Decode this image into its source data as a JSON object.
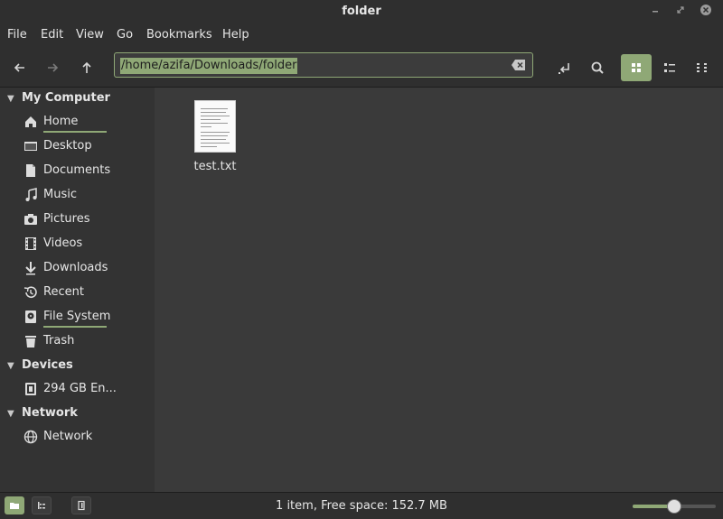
{
  "window": {
    "title": "folder"
  },
  "menubar": {
    "items": [
      "File",
      "Edit",
      "View",
      "Go",
      "Bookmarks",
      "Help"
    ]
  },
  "toolbar": {
    "path": "/home/azifa/Downloads/folder"
  },
  "sidebar": {
    "sections": [
      {
        "label": "My Computer"
      },
      {
        "label": "Devices"
      },
      {
        "label": "Network"
      }
    ],
    "computer_items": [
      {
        "label": "Home",
        "icon": "home-icon"
      },
      {
        "label": "Desktop",
        "icon": "desktop-icon"
      },
      {
        "label": "Documents",
        "icon": "document-icon"
      },
      {
        "label": "Music",
        "icon": "music-icon"
      },
      {
        "label": "Pictures",
        "icon": "camera-icon"
      },
      {
        "label": "Videos",
        "icon": "film-icon"
      },
      {
        "label": "Downloads",
        "icon": "download-icon"
      },
      {
        "label": "Recent",
        "icon": "history-icon"
      },
      {
        "label": "File System",
        "icon": "drive-icon"
      },
      {
        "label": "Trash",
        "icon": "trash-icon"
      }
    ],
    "device_items": [
      {
        "label": "294 GB En...",
        "icon": "disk-icon"
      }
    ],
    "network_items": [
      {
        "label": "Network",
        "icon": "network-icon"
      }
    ]
  },
  "files": [
    {
      "name": "test.txt",
      "icon": "text-file-icon"
    }
  ],
  "statusbar": {
    "text": "1 item, Free space: 152.7 MB"
  },
  "zoom": {
    "level": 0.5
  },
  "colors": {
    "accent": "#8fa876",
    "background": "#3a3a3a",
    "sidebar": "#333333"
  }
}
